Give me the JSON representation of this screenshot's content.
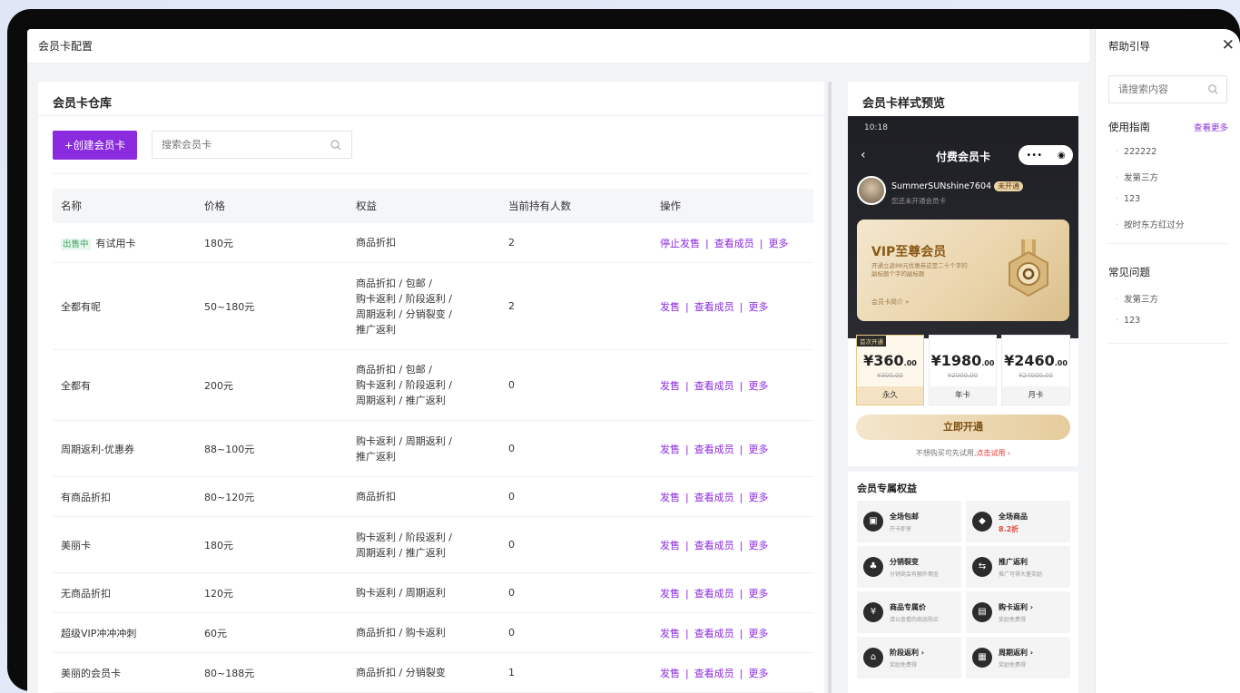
{
  "topbar": {
    "title": "会员卡配置"
  },
  "warehouse": {
    "title": "会员卡仓库",
    "create_button": "+创建会员卡",
    "search_placeholder": "搜索会员卡",
    "columns": [
      "名称",
      "价格",
      "权益",
      "当前持有人数",
      "操作"
    ],
    "rows": [
      {
        "tag": "出售中",
        "name": "有试用卡",
        "price": "180元",
        "rights": [
          "商品折扣"
        ],
        "holders": "2",
        "ops": [
          "停止发售",
          "查看成员",
          "更多"
        ]
      },
      {
        "tag": "",
        "name": "全都有呢",
        "price": "50~180元",
        "rights": [
          "商品折扣 / 包邮 /",
          "购卡返利 / 阶段返利 /",
          "周期返利 / 分销裂变 /",
          "推广返利"
        ],
        "holders": "2",
        "ops": [
          "发售",
          "查看成员",
          "更多"
        ]
      },
      {
        "tag": "",
        "name": "全都有",
        "price": "200元",
        "rights": [
          "商品折扣 / 包邮 /",
          "购卡返利 / 阶段返利 /",
          "周期返利 / 推广返利"
        ],
        "holders": "0",
        "ops": [
          "发售",
          "查看成员",
          "更多"
        ]
      },
      {
        "tag": "",
        "name": "周期返利-优惠券",
        "price": "88~100元",
        "rights": [
          "购卡返利 / 周期返利 /",
          "推广返利"
        ],
        "holders": "0",
        "ops": [
          "发售",
          "查看成员",
          "更多"
        ]
      },
      {
        "tag": "",
        "name": "有商品折扣",
        "price": "80~120元",
        "rights": [
          "商品折扣"
        ],
        "holders": "0",
        "ops": [
          "发售",
          "查看成员",
          "更多"
        ]
      },
      {
        "tag": "",
        "name": "美丽卡",
        "price": "180元",
        "rights": [
          "购卡返利 / 阶段返利 /",
          "周期返利 / 推广返利"
        ],
        "holders": "0",
        "ops": [
          "发售",
          "查看成员",
          "更多"
        ]
      },
      {
        "tag": "",
        "name": "无商品折扣",
        "price": "120元",
        "rights": [
          "购卡返利 / 周期返利"
        ],
        "holders": "0",
        "ops": [
          "发售",
          "查看成员",
          "更多"
        ]
      },
      {
        "tag": "",
        "name": "超级VIP冲冲冲刺",
        "price": "60元",
        "rights": [
          "商品折扣 / 购卡返利"
        ],
        "holders": "0",
        "ops": [
          "发售",
          "查看成员",
          "更多"
        ]
      },
      {
        "tag": "",
        "name": "美丽的会员卡",
        "price": "80~188元",
        "rights": [
          "商品折扣 / 分销裂变"
        ],
        "holders": "1",
        "ops": [
          "发售",
          "查看成员",
          "更多"
        ]
      }
    ]
  },
  "preview": {
    "title": "会员卡样式预览",
    "status_time": "10:18",
    "nav_title": "付费会员卡",
    "user_name": "SummerSUNshine7604",
    "user_badge": "未开通",
    "user_sub": "您还未开通会员卡",
    "card_title": "VIP至尊会员",
    "card_desc": "开通立返88元优惠券这是二十个字的副标题个字的副标题",
    "card_link": "会员卡简介 »",
    "prices": [
      {
        "tag": "首次开通",
        "value": "¥360",
        "dec": ".00",
        "orig": "¥300.00",
        "name": "永久"
      },
      {
        "tag": "",
        "value": "¥1980",
        "dec": ".00",
        "orig": "¥2000.00",
        "name": "年卡"
      },
      {
        "tag": "",
        "value": "¥2460",
        "dec": ".00",
        "orig": "¥24000.00",
        "name": "月卡"
      }
    ],
    "open_button": "立即开通",
    "trial_text": "不想购买可先试用,",
    "trial_link": "点击试用 ›",
    "rights_title": "会员专属权益",
    "rights": [
      {
        "name": "全场包邮",
        "sub": "开卡即享"
      },
      {
        "name": "全场商品",
        "sub": "8.2折"
      },
      {
        "name": "分销裂变",
        "sub": "分销商会有额外佣金"
      },
      {
        "name": "推广返利",
        "sub": "推广可得大量奖励"
      },
      {
        "name": "商品专属价",
        "sub": "请以查看的商品购买"
      },
      {
        "name": "购卡返利 ›",
        "sub": "奖励免费得"
      },
      {
        "name": "阶段返利 ›",
        "sub": "奖励免费得"
      },
      {
        "name": "周期返利 ›",
        "sub": "奖励免费得"
      }
    ]
  },
  "help": {
    "title": "帮助引导",
    "close": "✕",
    "search_placeholder": "请搜索内容",
    "guide_title": "使用指南",
    "guide_more": "查看更多",
    "guide_items": [
      "222222",
      "发第三方",
      "123",
      "按时东方红过分"
    ],
    "faq_title": "常见问题",
    "faq_items": [
      "发第三方",
      "123"
    ]
  },
  "colors": {
    "accent": "#8b2be0",
    "tag_green": "#3ba55d",
    "gold": "#e5cc9d"
  }
}
